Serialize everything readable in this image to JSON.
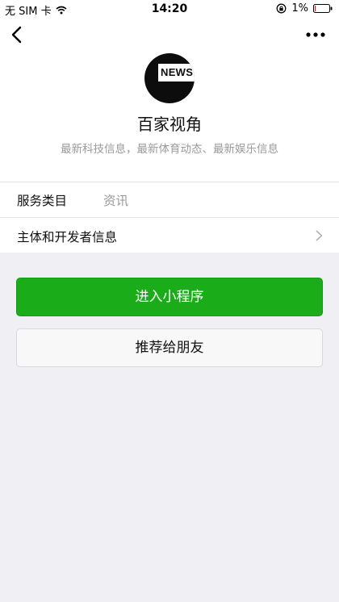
{
  "status_bar": {
    "carrier": "无 SIM 卡",
    "time": "14:20",
    "battery": "1%"
  },
  "app": {
    "logo_text": "NEWS",
    "name": "百家视角",
    "description": "最新科技信息，最新体育动态、最新娱乐信息"
  },
  "info": {
    "category_label": "服务类目",
    "category_value": "资讯",
    "developer_label": "主体和开发者信息"
  },
  "buttons": {
    "enter": "进入小程序",
    "share": "推荐给朋友"
  },
  "colors": {
    "primary": "#1aad19",
    "background": "#efeff4"
  }
}
